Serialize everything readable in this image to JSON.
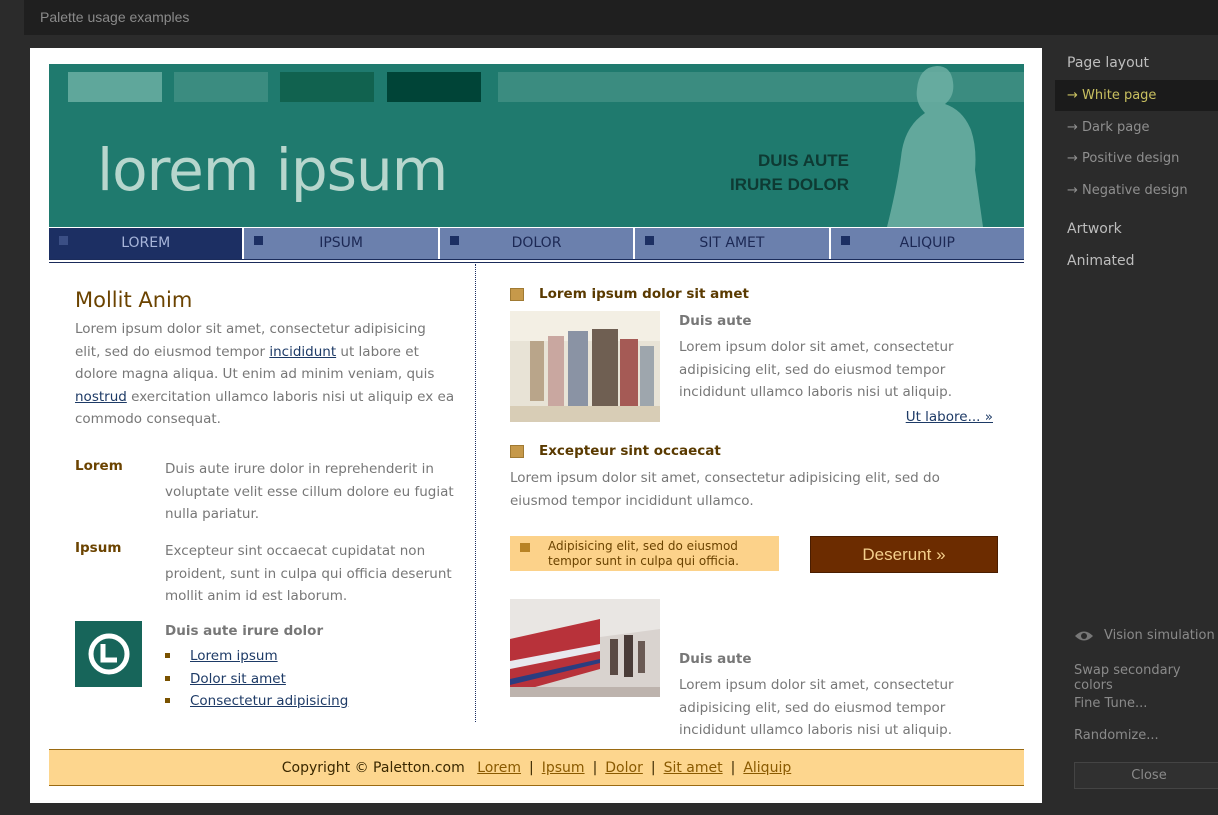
{
  "app": {
    "title": "Palette usage examples"
  },
  "panel": {
    "page_layout": "Page layout",
    "layouts": [
      "→  White page",
      "→  Dark page",
      "→  Positive design",
      "→  Negative design"
    ],
    "artwork": "Artwork",
    "animated": "Animated",
    "vision": "Vision simulation",
    "swap": "Swap secondary colors",
    "fine_tune": "Fine Tune...",
    "randomize": "Randomize...",
    "close": "Close"
  },
  "colors": {
    "banner": "#1f7a6e",
    "nav": "#6b80ad",
    "nav_active": "#1c2f63",
    "cta": "#6c2c00",
    "footer": "#fdd68e",
    "swatches": [
      "#5fa79b",
      "#3b8c80",
      "#11624f",
      "#004437"
    ]
  },
  "banner": {
    "title": "lorem ipsum",
    "sub_line1": "DUIS AUTE",
    "sub_line2": "IRURE DOLOR"
  },
  "nav": {
    "items": [
      "LOREM",
      "IPSUM",
      "DOLOR",
      "SIT AMET",
      "ALIQUIP"
    ]
  },
  "left": {
    "heading": "Mollit Anim",
    "para_a": "Lorem ipsum dolor sit amet, consectetur adipisicing elit, sed do eiusmod tempor ",
    "link1": "incididunt",
    "para_b": " ut labore et dolore magna aliqua. Ut enim ad minim veniam, quis ",
    "link2": "nostrud",
    "para_c": " exercitation ullamco laboris nisi ut aliquip ex ea commodo consequat.",
    "def1_term": "Lorem",
    "def1_desc": "Duis aute irure dolor in reprehenderit in voluptate velit esse cillum dolore eu fugiat nulla pariatur.",
    "def2_term": "Ipsum",
    "def2_desc": "Excepteur sint occaecat cupidatat non proident, sunt in culpa qui officia deserunt mollit anim id est laborum.",
    "list_title": "Duis aute irure dolor",
    "links": [
      "Lorem ipsum",
      "Dolor sit amet",
      "Consectetur adipisicing"
    ]
  },
  "right": {
    "sec1": "Lorem ipsum dolor sit amet",
    "item1_title": "Duis aute",
    "item1_text": "Lorem ipsum dolor sit amet, consectetur adipisicing elit, sed do eiusmod tempor incididunt ullamco laboris nisi ut aliquip.",
    "more": "Ut labore... »",
    "sec2": "Excepteur sint occaecat",
    "sec2_text": "Lorem ipsum dolor sit amet, consectetur adipisicing elit, sed do eiusmod tempor incididunt ullamco.",
    "callout": "Adipisicing elit, sed do eiusmod tempor sunt in culpa qui officia.",
    "cta": "Deserunt »",
    "item2_title": "Duis aute",
    "item2_text": "Lorem ipsum dolor sit amet, consectetur adipisicing elit, sed do eiusmod tempor incididunt ullamco laboris nisi ut aliquip."
  },
  "footer": {
    "copyright": "Copyright © Paletton.com",
    "links": [
      "Lorem",
      "Ipsum",
      "Dolor",
      "Sit amet",
      "Aliquip"
    ]
  }
}
